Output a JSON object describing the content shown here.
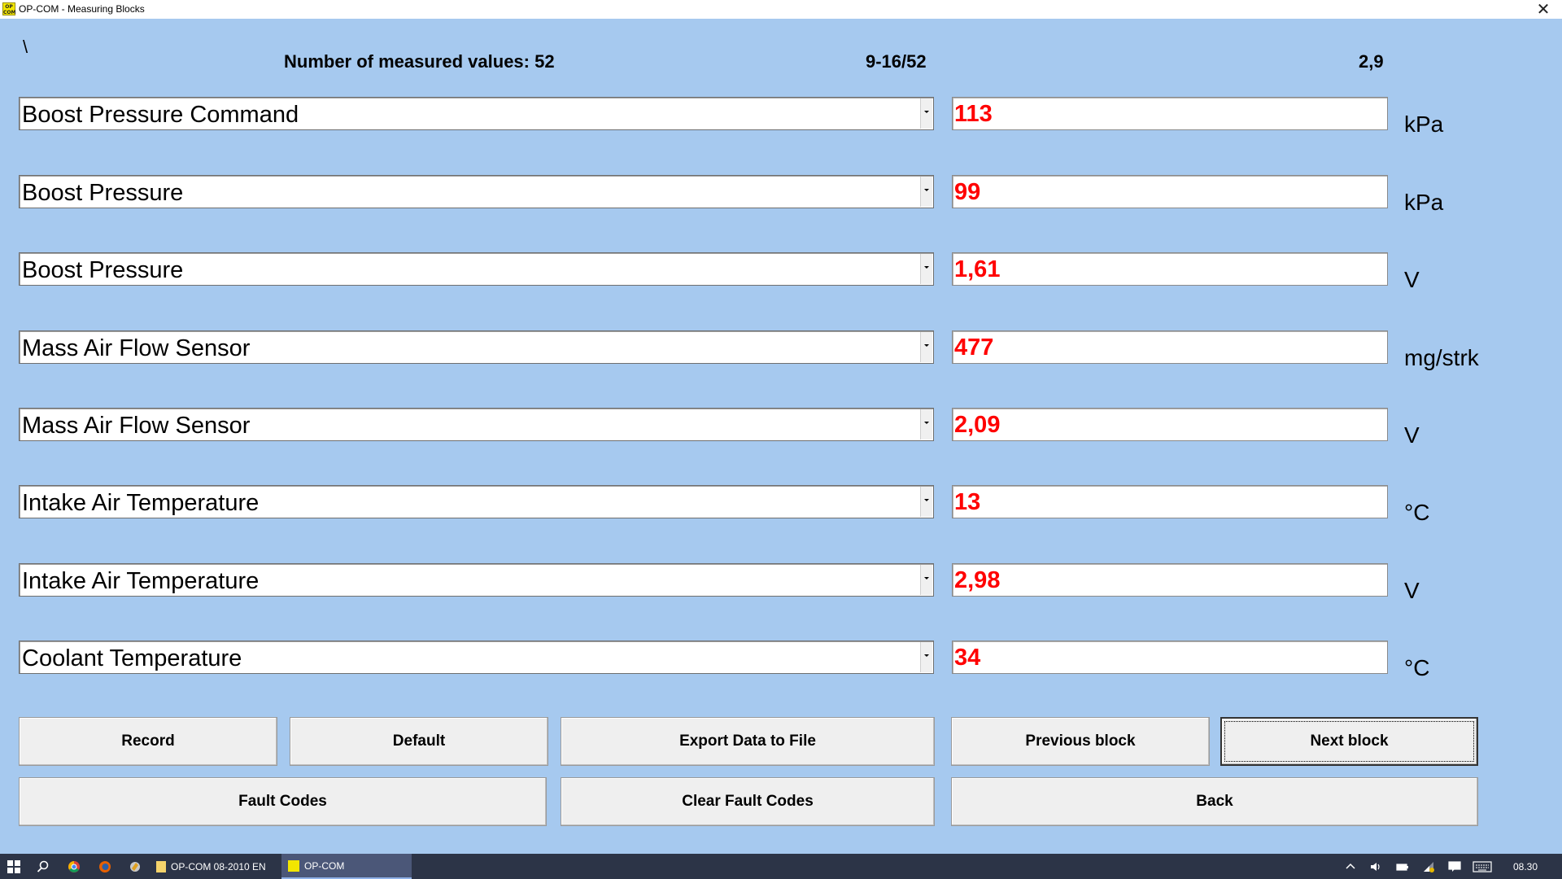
{
  "window": {
    "title": "OP-COM - Measuring Blocks",
    "icon_text": "OP COM",
    "close_glyph": "✕"
  },
  "header": {
    "path": "\\",
    "count_label": "Number of measured values: 52",
    "range_label": "9-16/52",
    "version_label": "2,9"
  },
  "measurements": [
    {
      "name": "Boost Pressure Command",
      "value": "113",
      "unit": "kPa"
    },
    {
      "name": "Boost Pressure",
      "value": "99",
      "unit": "kPa"
    },
    {
      "name": "Boost Pressure",
      "value": "1,61",
      "unit": "V"
    },
    {
      "name": "Mass Air Flow Sensor",
      "value": "477",
      "unit": "mg/strk"
    },
    {
      "name": "Mass Air Flow Sensor",
      "value": "2,09",
      "unit": "V"
    },
    {
      "name": "Intake Air Temperature",
      "value": "13",
      "unit": "°C"
    },
    {
      "name": "Intake Air Temperature",
      "value": "2,98",
      "unit": "V"
    },
    {
      "name": "Coolant Temperature",
      "value": "34",
      "unit": "°C"
    }
  ],
  "buttons": {
    "record": "Record",
    "default": "Default",
    "export": "Export Data to File",
    "previous": "Previous block",
    "next": "Next block",
    "fault_codes": "Fault Codes",
    "clear_fault_codes": "Clear Fault Codes",
    "back": "Back"
  },
  "taskbar": {
    "items": [
      {
        "label": "OP-COM 08-2010 EN"
      },
      {
        "label": "OP-COM"
      }
    ],
    "clock": "08.30"
  },
  "colors": {
    "background": "#a6c9ef",
    "value_text": "#ff0000",
    "taskbar": "#2c3447"
  }
}
